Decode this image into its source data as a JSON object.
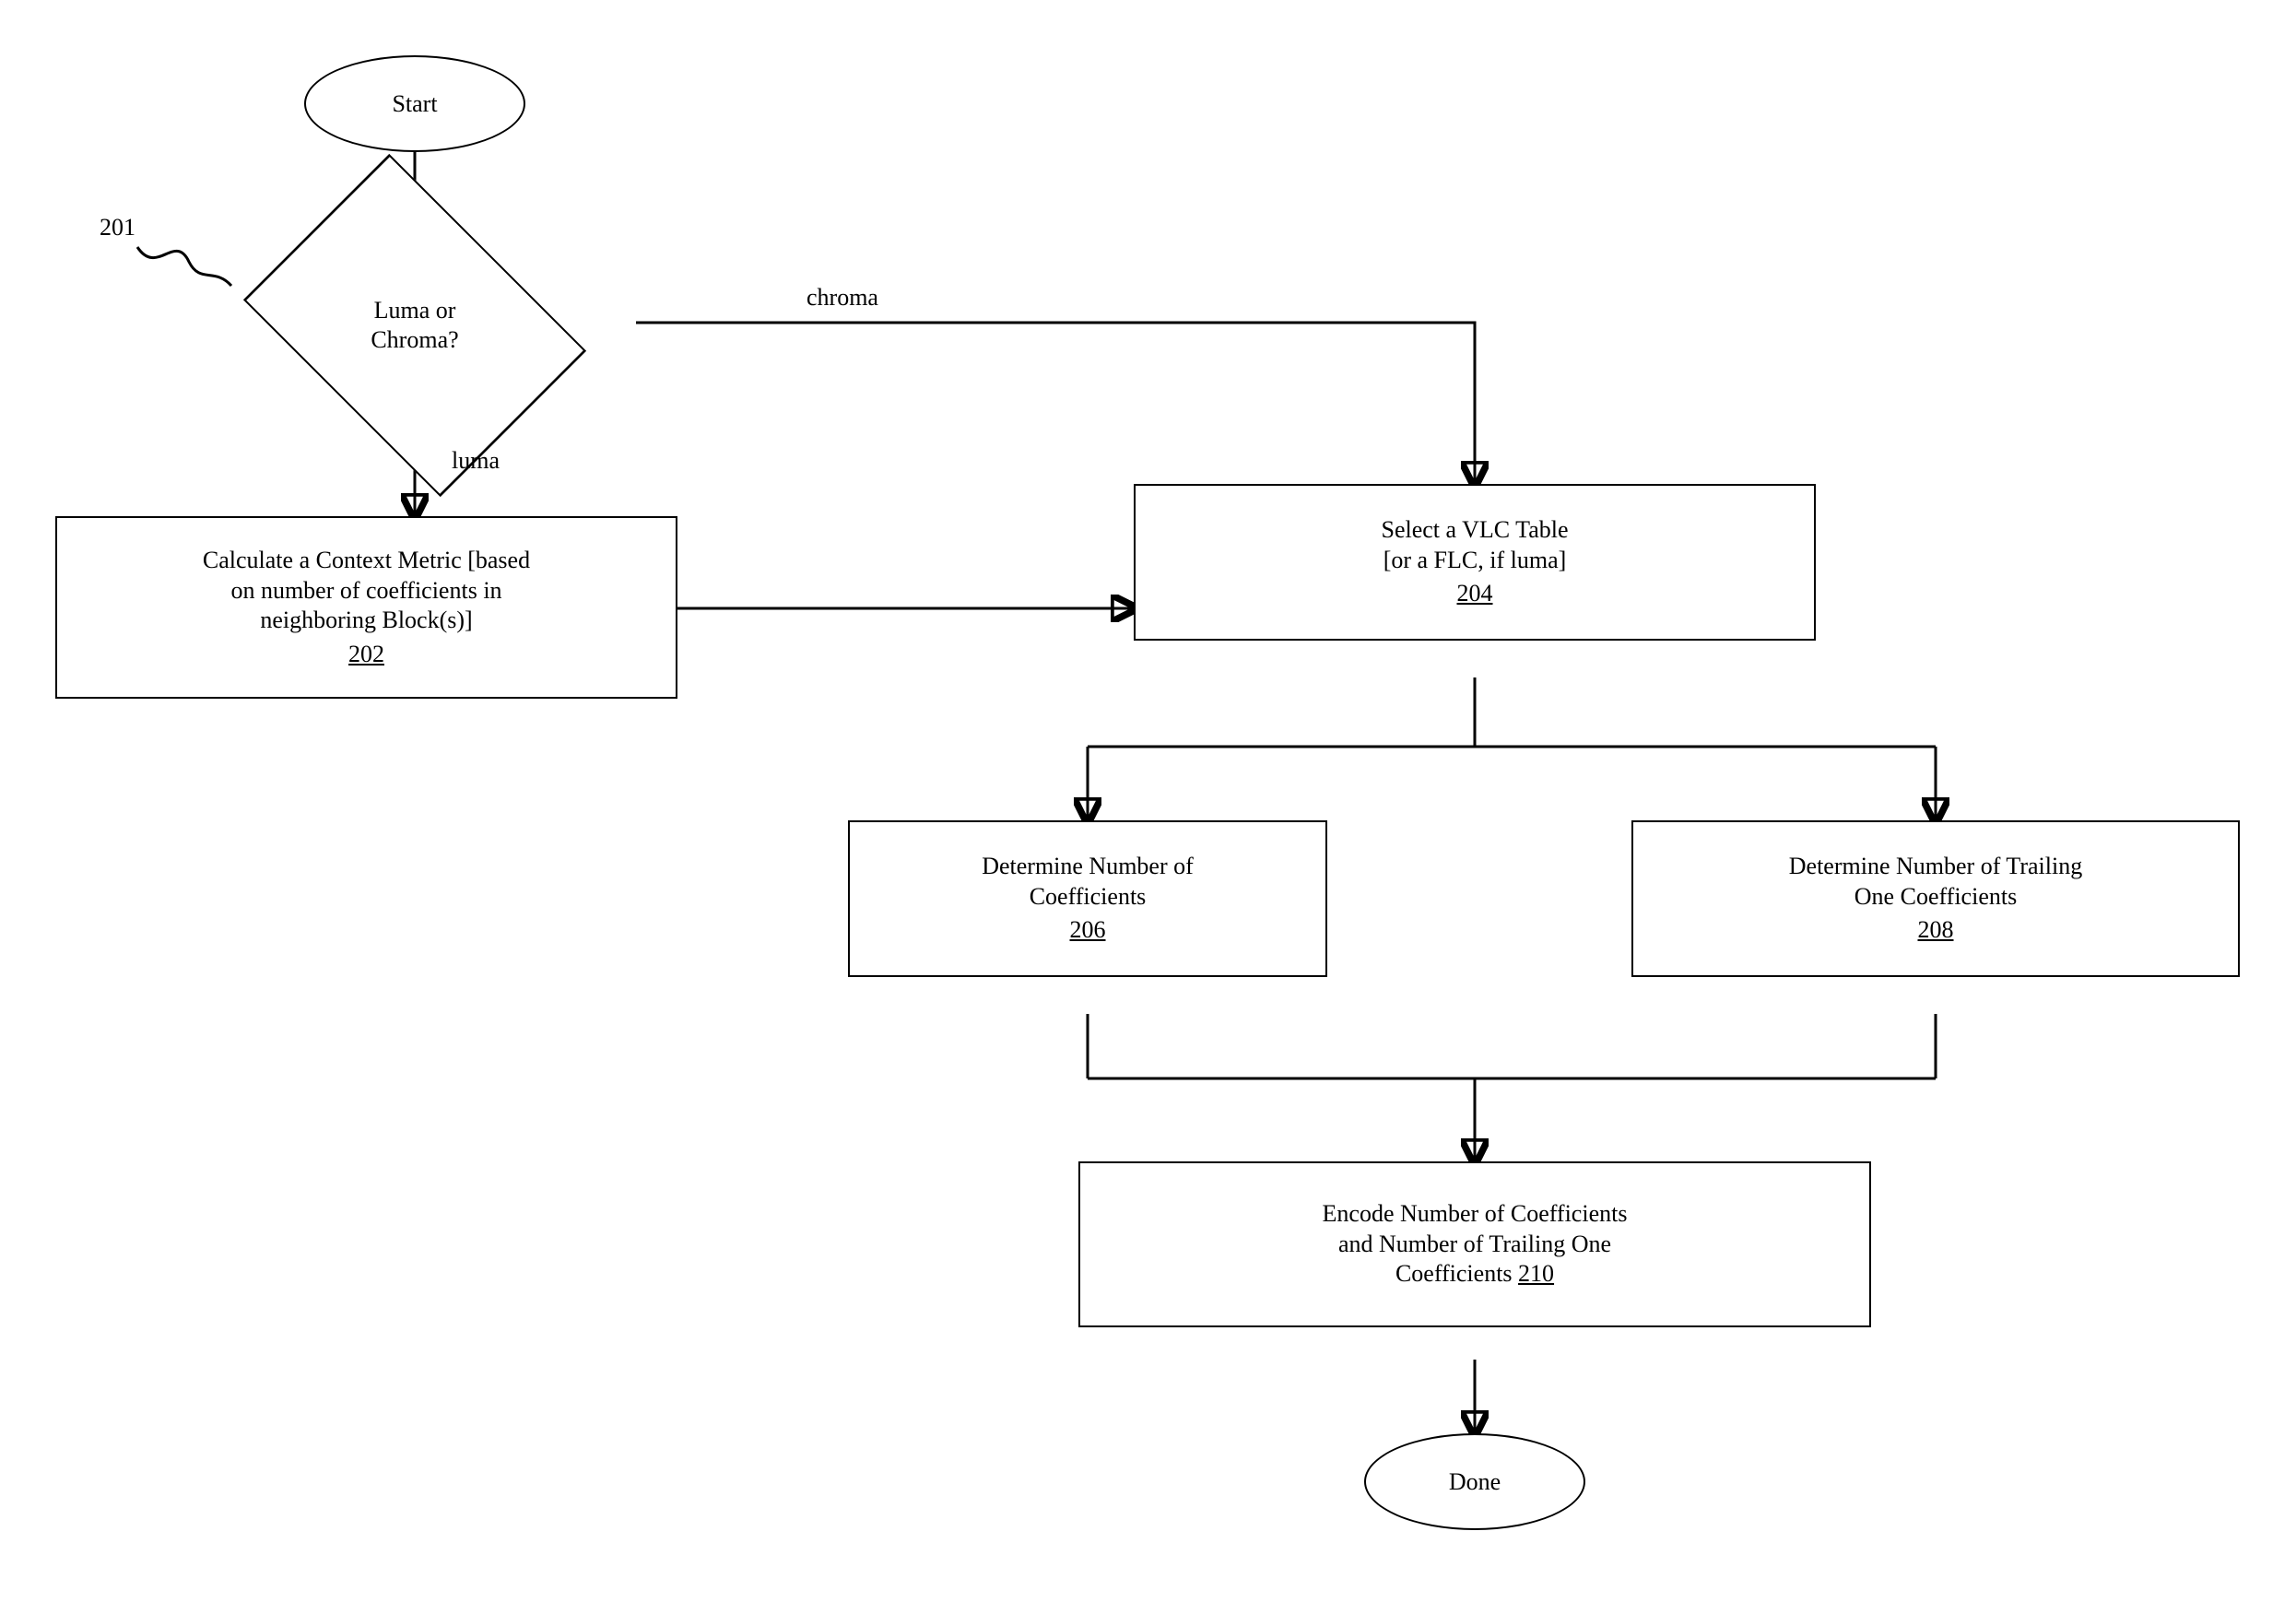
{
  "callouts": {
    "decision_ref": "201"
  },
  "terminals": {
    "start": "Start",
    "done": "Done"
  },
  "decision": {
    "label_line1": "Luma or",
    "label_line2": "Chroma?",
    "branch_chroma": "chroma",
    "branch_luma": "luma"
  },
  "nodes": {
    "context_metric": {
      "line1": "Calculate a Context Metric [based",
      "line2": "on number of coefficients in",
      "line3": "neighboring Block(s)]",
      "ref": "202"
    },
    "select_vlc": {
      "line1": "Select a VLC Table",
      "line2": "[or a FLC, if luma]",
      "ref": "204"
    },
    "det_num_coeff": {
      "line1": "Determine Number of",
      "line2": "Coefficients",
      "ref": "206"
    },
    "det_trailing_ones": {
      "line1": "Determine Number of Trailing",
      "line2": "One Coefficients",
      "ref": "208"
    },
    "encode": {
      "line1": "Encode Number of Coefficients",
      "line2": "and Number of Trailing One",
      "line3_prefix": "Coefficients ",
      "ref": "210"
    }
  }
}
